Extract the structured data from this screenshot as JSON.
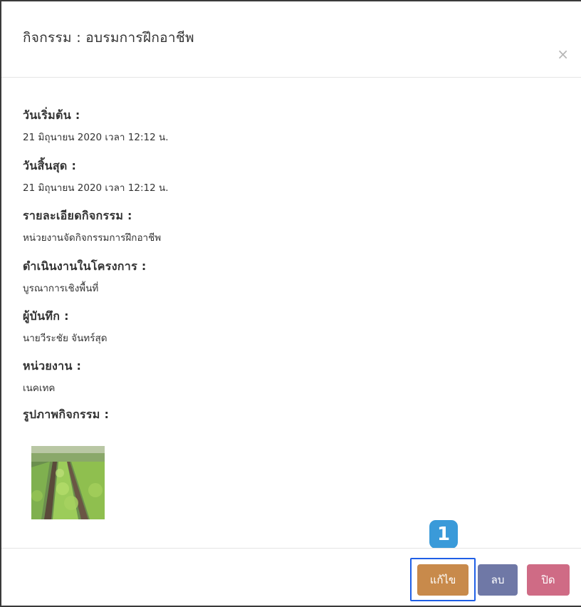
{
  "modal": {
    "title": "กิจกรรม : อบรมการฝึกอาชีพ",
    "close_glyph": "×"
  },
  "fields": [
    {
      "label": "วันเริ่มต้น :",
      "value": "21 มิถุนายน 2020 เวลา 12:12 น."
    },
    {
      "label": "วันสิ้นสุด :",
      "value": "21 มิถุนายน 2020 เวลา 12:12 น."
    },
    {
      "label": "รายละเอียดกิจกรรม :",
      "value": "หน่วยงานจัดกิจกรรมการฝึกอาชีพ"
    },
    {
      "label": "ดำเนินงานในโครงการ :",
      "value": "บูรณาการเชิงพื้นที่"
    },
    {
      "label": "ผู้บันทึก :",
      "value": "นายวีระชัย จันทร์สุด"
    },
    {
      "label": "หน่วยงาน :",
      "value": "เนคเทค"
    }
  ],
  "photos_label": "รูปภาพกิจกรรม :",
  "footer": {
    "edit_label": "แก้ไข",
    "delete_label": "ลบ",
    "close_label": "ปิด",
    "step_badge": "1"
  },
  "colors": {
    "edit": "#c88a4b",
    "delete": "#6f78a6",
    "close": "#cf6b85",
    "highlight": "#1f5fe6",
    "badge": "#3a9ad9"
  }
}
